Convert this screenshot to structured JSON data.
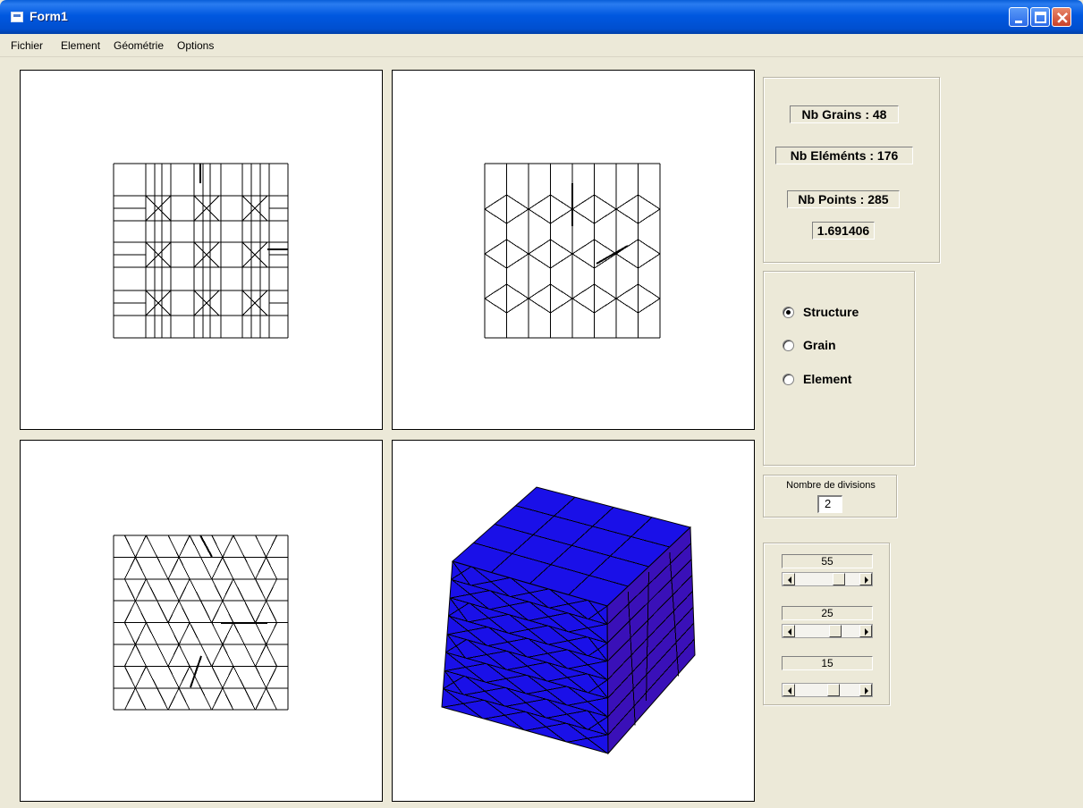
{
  "window": {
    "title": "Form1",
    "titlebar_color": "#0055e5"
  },
  "menu": {
    "items": [
      "Fichier",
      "Element",
      "Géométrie",
      "Options"
    ]
  },
  "stats": {
    "grains": "Nb Grains : 48",
    "elements": "Nb Eléménts : 176",
    "points": "Nb Points : 285",
    "value": "1.691406"
  },
  "view_mode": {
    "options": [
      "Structure",
      "Grain",
      "Element"
    ],
    "selected": "Structure"
  },
  "divisions": {
    "label": "Nombre de divisions",
    "value": "2"
  },
  "rotation": {
    "sliders": [
      {
        "label": "55"
      },
      {
        "label": "25"
      },
      {
        "label": "15"
      }
    ]
  },
  "viewports": {
    "cube_color": "#1a10e8",
    "cube_side_color": "#3a10b8",
    "mesh_color": "#000000",
    "background": "#ffffff"
  }
}
